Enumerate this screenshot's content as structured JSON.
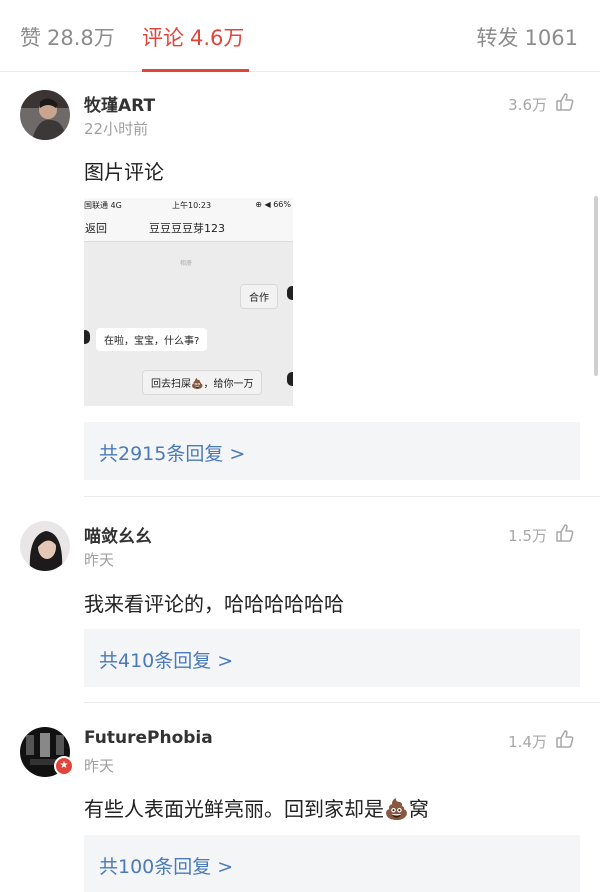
{
  "tabs": {
    "likes": {
      "label": "赞",
      "count": "28.8万"
    },
    "comments": {
      "label": "评论",
      "count": "4.6万"
    },
    "reposts": {
      "label": "转发",
      "count": "1061"
    }
  },
  "colors": {
    "accent": "#e0453b",
    "link": "#4a7ab8",
    "reply_bg": "#f4f5f7"
  },
  "comments": [
    {
      "username": "牧瑾ART",
      "time": "22小时前",
      "likes": "3.6万",
      "text": "图片评论",
      "replies": "共2915条回复 >",
      "image": {
        "carrier": "国联通 4G",
        "clock": "上午10:23",
        "battery": "⊕ ◀ 66%",
        "back": "返回",
        "title": "豆豆豆豆芽123",
        "system_note": "相册",
        "messages": [
          "合作",
          "在啦，宝宝，什么事?",
          "回去扫屎💩，给你一万"
        ]
      }
    },
    {
      "username": "喵敛幺幺",
      "time": "昨天",
      "likes": "1.5万",
      "text": "我来看评论的，哈哈哈哈哈哈",
      "replies": "共410条回复 >"
    },
    {
      "username": "FuturePhobia",
      "time": "昨天",
      "likes": "1.4万",
      "text": "有些人表面光鲜亮丽。回到家却是💩窝",
      "replies": "共100条回复 >"
    }
  ]
}
